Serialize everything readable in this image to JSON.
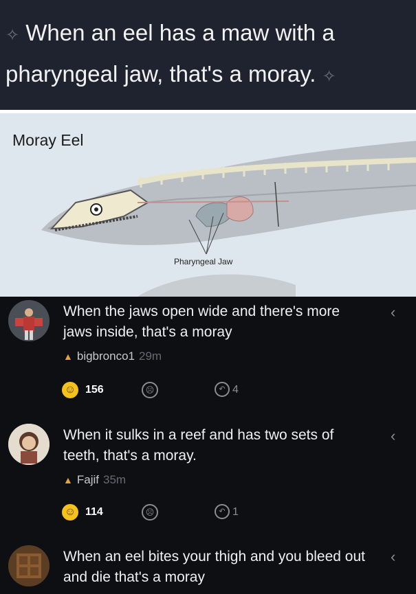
{
  "header": {
    "caption": "When an eel has a maw with a pharyngeal jaw, that's a moray."
  },
  "illustration": {
    "title": "Moray Eel",
    "label": "Pharyngeal Jaw"
  },
  "comments": [
    {
      "text": "When the jaws open wide and there's more jaws inside, that's a moray",
      "user": "bigbronco1",
      "time": "29m",
      "likes": "156",
      "replies": "4"
    },
    {
      "text": "When it sulks in a reef and has two sets of teeth, that's a moray.",
      "user": "Fajif",
      "time": "35m",
      "likes": "114",
      "replies": "1"
    },
    {
      "text": "When an eel bites your thigh and you bleed out and die that's a moray"
    }
  ],
  "icons": {
    "sparkle": "sparkle-icon",
    "flame": "flame-icon",
    "smile": "smile-emoji-icon",
    "frown": "frown-icon",
    "reply": "reply-icon",
    "chevron": "chevron-left-icon"
  },
  "colors": {
    "header_bg": "#1f2330",
    "feed_bg": "#0e0f13",
    "smile": "#f5c21b",
    "flame": "#e8a33a"
  }
}
